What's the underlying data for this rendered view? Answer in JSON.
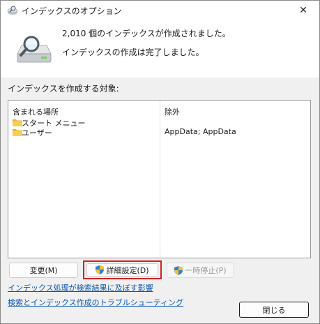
{
  "window": {
    "title": "インデックスのオプション",
    "close_glyph": "✕"
  },
  "status": {
    "line1": "2,010 個のインデックスが作成されました。",
    "line2": "インデックスの作成は完了しました。"
  },
  "section_label": "インデックスを作成する対象:",
  "list": {
    "col_location": "含まれる場所",
    "col_exclude": "除外",
    "rows": [
      {
        "name": "スタート メニュー",
        "exclude": ""
      },
      {
        "name": "ユーザー",
        "exclude": "AppData; AppData"
      }
    ]
  },
  "buttons": {
    "modify": "変更(M)",
    "advanced": "詳細設定(D)",
    "pause": "一時停止(P)",
    "close": "閉じる"
  },
  "links": {
    "how_affects": "インデックス処理が検索結果に及ぼす影響",
    "troubleshoot": "検索とインデックス作成のトラブルシューティング"
  },
  "icons": {
    "title": "indexing-options-icon",
    "large": "drive-magnifier-icon",
    "folder": "folder-icon",
    "shield": "uac-shield-icon"
  },
  "colors": {
    "accent_red": "#d61f1f",
    "link": "#0b57b3"
  }
}
